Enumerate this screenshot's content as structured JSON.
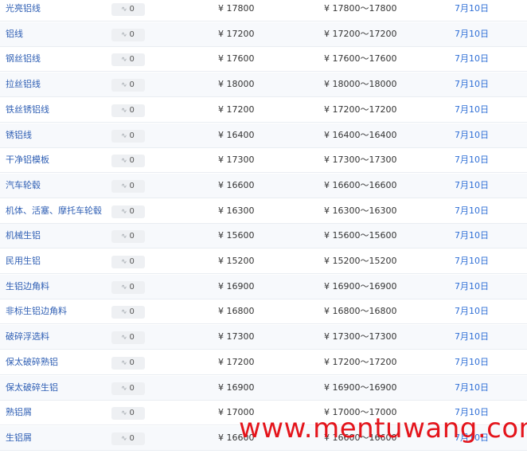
{
  "currency_symbol": "¥",
  "watermark_text": "www.mentuwang.com",
  "rows": [
    {
      "name": "光亮铝线",
      "change": "0",
      "price": "17800",
      "range": "17800～17800",
      "date": "7月10日"
    },
    {
      "name": "铝线",
      "change": "0",
      "price": "17200",
      "range": "17200～17200",
      "date": "7月10日"
    },
    {
      "name": "钢丝铝线",
      "change": "0",
      "price": "17600",
      "range": "17600～17600",
      "date": "7月10日"
    },
    {
      "name": "拉丝铝线",
      "change": "0",
      "price": "18000",
      "range": "18000～18000",
      "date": "7月10日"
    },
    {
      "name": "铁丝锈铝线",
      "change": "0",
      "price": "17200",
      "range": "17200～17200",
      "date": "7月10日"
    },
    {
      "name": "锈铝线",
      "change": "0",
      "price": "16400",
      "range": "16400～16400",
      "date": "7月10日"
    },
    {
      "name": "干净铝模板",
      "change": "0",
      "price": "17300",
      "range": "17300～17300",
      "date": "7月10日"
    },
    {
      "name": "汽车轮毂",
      "change": "0",
      "price": "16600",
      "range": "16600～16600",
      "date": "7月10日"
    },
    {
      "name": "机体、活塞、摩托车轮毂",
      "change": "0",
      "price": "16300",
      "range": "16300～16300",
      "date": "7月10日"
    },
    {
      "name": "机械生铝",
      "change": "0",
      "price": "15600",
      "range": "15600～15600",
      "date": "7月10日"
    },
    {
      "name": "民用生铝",
      "change": "0",
      "price": "15200",
      "range": "15200～15200",
      "date": "7月10日"
    },
    {
      "name": "生铝边角料",
      "change": "0",
      "price": "16900",
      "range": "16900～16900",
      "date": "7月10日"
    },
    {
      "name": "非标生铝边角料",
      "change": "0",
      "price": "16800",
      "range": "16800～16800",
      "date": "7月10日"
    },
    {
      "name": "破碎浮选料",
      "change": "0",
      "price": "17300",
      "range": "17300～17300",
      "date": "7月10日"
    },
    {
      "name": "保太破碎熟铝",
      "change": "0",
      "price": "17200",
      "range": "17200～17200",
      "date": "7月10日"
    },
    {
      "name": "保太破碎生铝",
      "change": "0",
      "price": "16900",
      "range": "16900～16900",
      "date": "7月10日"
    },
    {
      "name": "熟铝屑",
      "change": "0",
      "price": "17000",
      "range": "17000～17000",
      "date": "7月10日"
    },
    {
      "name": "生铝屑",
      "change": "0",
      "price": "16600",
      "range": "16600～16600",
      "date": "7月10日"
    }
  ]
}
